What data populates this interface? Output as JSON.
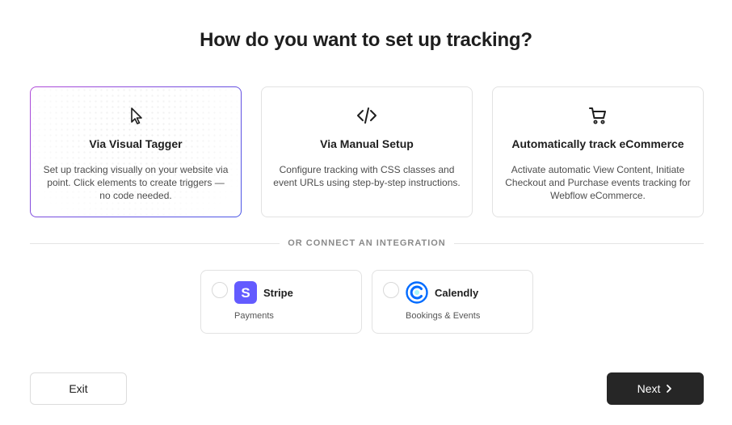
{
  "page": {
    "title": "How do you want to set up tracking?"
  },
  "options": [
    {
      "title": "Via Visual Tagger",
      "description": "Set up tracking visually on your website via point. Click elements to create triggers — no code needed.",
      "icon": "cursor-icon",
      "selected": true
    },
    {
      "title": "Via Manual Setup",
      "description": "Configure tracking with CSS classes and event URLs using step-by-step instructions.",
      "icon": "code-icon",
      "selected": false
    },
    {
      "title": "Automatically track eCommerce",
      "description": "Activate automatic View Content, Initiate Checkout and Purchase events tracking for Webflow eCommerce.",
      "icon": "shopping-cart-icon",
      "selected": false
    }
  ],
  "divider": {
    "label": "OR CONNECT AN INTEGRATION"
  },
  "integrations": [
    {
      "name": "Stripe",
      "subtitle": "Payments",
      "logo_letter": "S",
      "color": "#635bff",
      "icon": "stripe-logo"
    },
    {
      "name": "Calendly",
      "subtitle": "Bookings & Events",
      "color": "#006bff",
      "icon": "calendly-logo"
    }
  ],
  "footer": {
    "exit_label": "Exit",
    "next_label": "Next",
    "next_icon": "chevron-right-icon"
  },
  "colors": {
    "selected_border_start": "#b14ad8",
    "selected_border_end": "#4b57e6",
    "primary_button": "#262626"
  }
}
